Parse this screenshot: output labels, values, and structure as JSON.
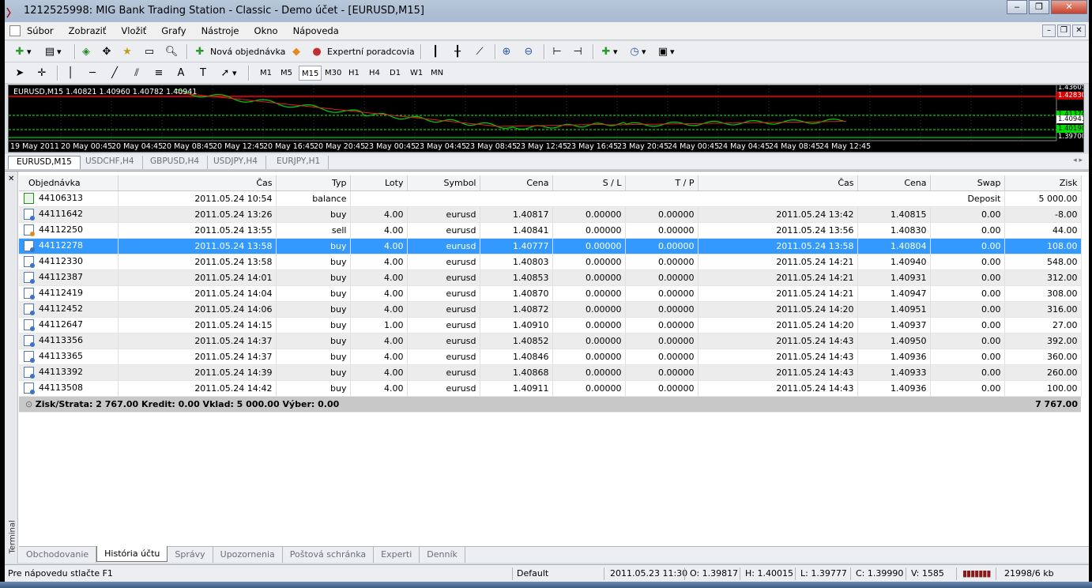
{
  "window": {
    "title": "1212525998: MIG Bank Trading Station - Classic - Demo účet - [EURUSD,M15]"
  },
  "menu": [
    "Súbor",
    "Zobraziť",
    "Vložiť",
    "Grafy",
    "Nástroje",
    "Okno",
    "Nápoveda"
  ],
  "toolbar": {
    "new_order": "Nová objednávka",
    "expert_advisors": "Expertní poradcovia",
    "timeframes": [
      "M1",
      "M5",
      "M15",
      "M30",
      "H1",
      "H4",
      "D1",
      "W1",
      "MN"
    ],
    "active_timeframe": "M15"
  },
  "chart": {
    "title": "EURUSD,M15  1.40821 1.40960 1.40782 1.40941",
    "price_labels": [
      "1.43605",
      "1.42830",
      "1.41370",
      "1.40941",
      "1.40190",
      "1.39700"
    ],
    "x_labels": [
      "19 May 2011",
      "20 May 00:45",
      "20 May 04:45",
      "20 May 08:45",
      "20 May 12:45",
      "20 May 16:45",
      "20 May 20:45",
      "23 May 00:45",
      "23 May 04:45",
      "23 May 08:45",
      "23 May 12:45",
      "23 May 16:45",
      "23 May 20:45",
      "24 May 00:45",
      "24 May 04:45",
      "24 May 08:45",
      "24 May 12:45"
    ],
    "colors": {
      "price": "#00c800",
      "ma": "#e02020",
      "hline_red": "#ff0000",
      "hline_green": "#00ff00"
    }
  },
  "chart_tabs": [
    "EURUSD,M15",
    "USDCHF,H4",
    "GBPUSD,H4",
    "USDJPY,H4",
    "EURJPY,H1"
  ],
  "history": {
    "headers": [
      "Objednávka",
      "Čas",
      "Typ",
      "Loty",
      "Symbol",
      "Cena",
      "S / L",
      "T / P",
      "Čas",
      "Cena",
      "Swap",
      "Zisk"
    ],
    "balance_row": {
      "order": "44106313",
      "time": "2011.05.24 10:54",
      "type": "balance",
      "comment": "Deposit",
      "profit": "5 000.00"
    },
    "rows": [
      [
        "44111642",
        "2011.05.24 13:26",
        "buy",
        "4.00",
        "eurusd",
        "1.40817",
        "0.00000",
        "0.00000",
        "2011.05.24 13:42",
        "1.40815",
        "0.00",
        "-8.00"
      ],
      [
        "44112250",
        "2011.05.24 13:55",
        "sell",
        "4.00",
        "eurusd",
        "1.40841",
        "0.00000",
        "0.00000",
        "2011.05.24 13:56",
        "1.40830",
        "0.00",
        "44.00"
      ],
      [
        "44112278",
        "2011.05.24 13:58",
        "buy",
        "4.00",
        "eurusd",
        "1.40777",
        "0.00000",
        "0.00000",
        "2011.05.24 13:58",
        "1.40804",
        "0.00",
        "108.00"
      ],
      [
        "44112330",
        "2011.05.24 13:58",
        "buy",
        "4.00",
        "eurusd",
        "1.40803",
        "0.00000",
        "0.00000",
        "2011.05.24 14:21",
        "1.40940",
        "0.00",
        "548.00"
      ],
      [
        "44112387",
        "2011.05.24 14:01",
        "buy",
        "4.00",
        "eurusd",
        "1.40853",
        "0.00000",
        "0.00000",
        "2011.05.24 14:21",
        "1.40931",
        "0.00",
        "312.00"
      ],
      [
        "44112419",
        "2011.05.24 14:04",
        "buy",
        "4.00",
        "eurusd",
        "1.40870",
        "0.00000",
        "0.00000",
        "2011.05.24 14:21",
        "1.40947",
        "0.00",
        "308.00"
      ],
      [
        "44112452",
        "2011.05.24 14:06",
        "buy",
        "4.00",
        "eurusd",
        "1.40872",
        "0.00000",
        "0.00000",
        "2011.05.24 14:20",
        "1.40951",
        "0.00",
        "316.00"
      ],
      [
        "44112647",
        "2011.05.24 14:15",
        "buy",
        "1.00",
        "eurusd",
        "1.40910",
        "0.00000",
        "0.00000",
        "2011.05.24 14:20",
        "1.40937",
        "0.00",
        "27.00"
      ],
      [
        "44113356",
        "2011.05.24 14:37",
        "buy",
        "4.00",
        "eurusd",
        "1.40852",
        "0.00000",
        "0.00000",
        "2011.05.24 14:43",
        "1.40950",
        "0.00",
        "392.00"
      ],
      [
        "44113365",
        "2011.05.24 14:37",
        "buy",
        "4.00",
        "eurusd",
        "1.40846",
        "0.00000",
        "0.00000",
        "2011.05.24 14:43",
        "1.40936",
        "0.00",
        "360.00"
      ],
      [
        "44113392",
        "2011.05.24 14:39",
        "buy",
        "4.00",
        "eurusd",
        "1.40868",
        "0.00000",
        "0.00000",
        "2011.05.24 14:43",
        "1.40933",
        "0.00",
        "260.00"
      ],
      [
        "44113508",
        "2011.05.24 14:42",
        "buy",
        "4.00",
        "eurusd",
        "1.40911",
        "0.00000",
        "0.00000",
        "2011.05.24 14:43",
        "1.40936",
        "0.00",
        "100.00"
      ]
    ],
    "selected_order": "44112278",
    "summary": "Zisk/Strata: 2 767.00  Kredit: 0.00  Vklad: 5 000.00  Výber: 0.00",
    "summary_total": "7 767.00"
  },
  "terminal": {
    "side_label": "Terminal",
    "tabs": [
      "Obchodovanie",
      "História účtu",
      "Správy",
      "Upozornenia",
      "Poštová schránka",
      "Experti",
      "Denník"
    ],
    "active_tab": "História účtu"
  },
  "status": {
    "help": "Pre nápovedu stlačte F1",
    "profile": "Default",
    "datetime": "2011.05.23 11:30",
    "open": "O: 1.39817",
    "high": "H: 1.40015",
    "low": "L: 1.39777",
    "close": "C: 1.39990",
    "volume": "V: 1585",
    "traffic": "21998/6 kb"
  }
}
